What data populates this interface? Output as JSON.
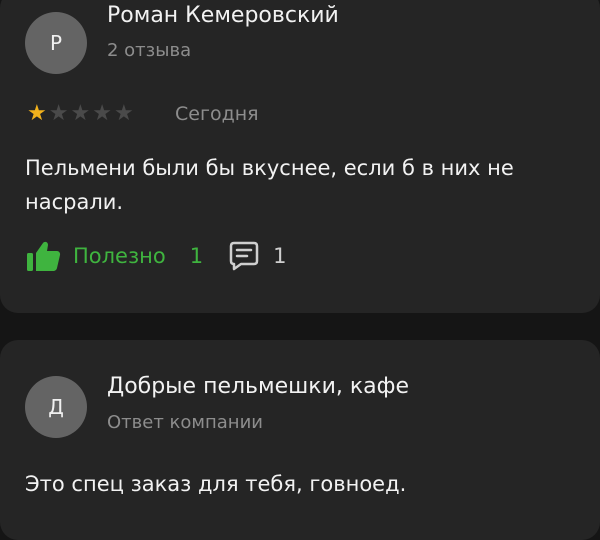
{
  "review": {
    "author_initial": "Р",
    "author_name": "Роман Кемеровский",
    "author_reviews": "2 отзыва",
    "rating": 1,
    "rating_max": 5,
    "date": "Сегодня",
    "text": "Пельмени были бы вкуснее, если б в них не насрали.",
    "useful_label": "Полезно",
    "useful_count": "1",
    "comments_count": "1",
    "colors": {
      "star_filled": "#f2b21c",
      "star_empty": "#4a4a4a",
      "like_accent": "#3fb43f"
    },
    "icons": {
      "like": "thumbs-up-icon",
      "comments": "comment-icon"
    }
  },
  "reply": {
    "author_initial": "Д",
    "author_name": "Добрые пельмешки, кафе",
    "author_role": "Ответ компании",
    "text": "Это спец заказ для тебя, говноед."
  }
}
